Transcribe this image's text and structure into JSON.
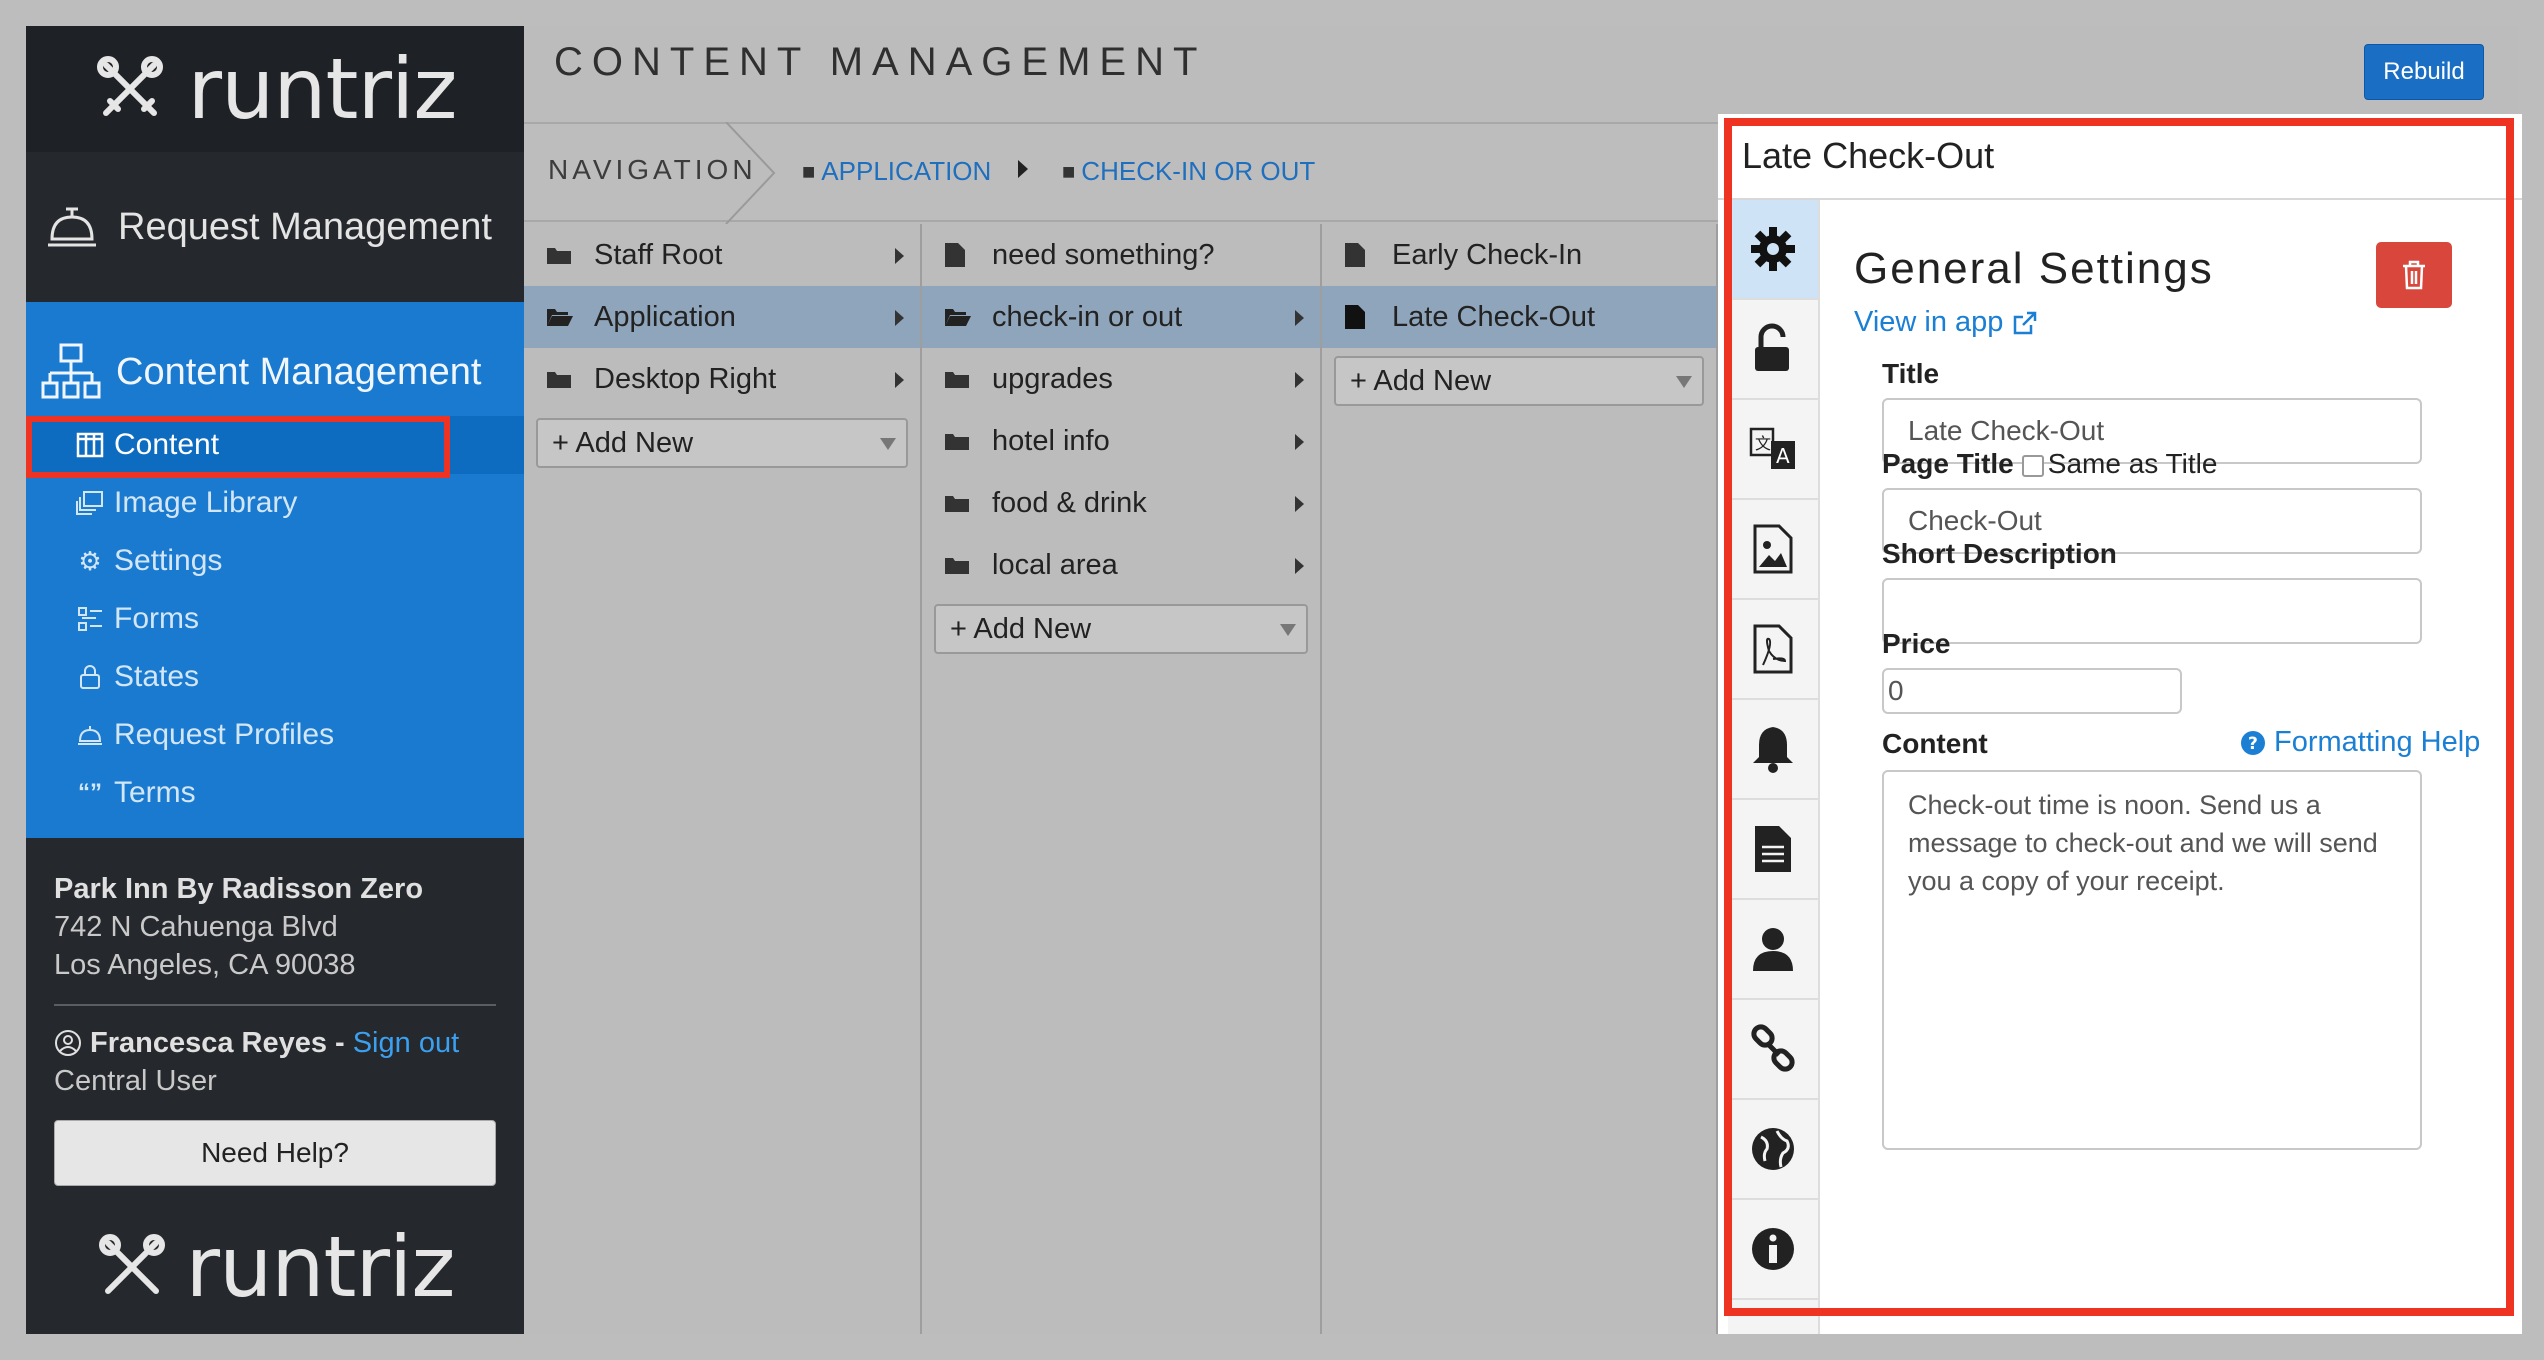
{
  "brand": {
    "logo_text": "runtriz"
  },
  "sidebar": {
    "request_management": "Request Management",
    "content_management": "Content Management",
    "items": [
      {
        "label": "Content",
        "icon": "columns-icon"
      },
      {
        "label": "Image Library",
        "icon": "images-icon"
      },
      {
        "label": "Settings",
        "icon": "gear-icon"
      },
      {
        "label": "Forms",
        "icon": "form-icon"
      },
      {
        "label": "States",
        "icon": "lock-icon"
      },
      {
        "label": "Request Profiles",
        "icon": "bell-icon"
      },
      {
        "label": "Terms",
        "icon": "quote-icon"
      }
    ],
    "hotel": {
      "name": "Park Inn By Radisson Zero",
      "address1": "742 N Cahuenga Blvd",
      "address2": "Los Angeles, CA 90038"
    },
    "user": {
      "name": "Francesca Reyes - ",
      "sign_out": "Sign out",
      "role": "Central User"
    },
    "help_button": "Need Help?"
  },
  "header": {
    "title": "CONTENT MANAGEMENT",
    "rebuild_button": "Rebuild"
  },
  "breadcrumb": {
    "nav_label": "NAVIGATION",
    "items": [
      "APPLICATION",
      "CHECK-IN OR OUT"
    ]
  },
  "columns": {
    "col1": {
      "items": [
        "Staff Root",
        "Application",
        "Desktop Right"
      ],
      "add_new": "+ Add New"
    },
    "col2": {
      "items": [
        "need something?",
        "check-in or out",
        "upgrades",
        "hotel info",
        "food & drink",
        "local area"
      ],
      "add_new": "+ Add New"
    },
    "col3": {
      "items": [
        "Early Check-In",
        "Late Check-Out"
      ],
      "add_new": "+ Add New"
    }
  },
  "panel": {
    "heading": "Late Check-Out",
    "section_title": "General Settings",
    "view_in_app": "View in app",
    "fields": {
      "title_label": "Title",
      "title_value": "Late Check-Out",
      "page_title_label": "Page Title",
      "same_as_title": "Same as Title",
      "page_title_value": "Check-Out",
      "short_desc_label": "Short Description",
      "short_desc_value": "",
      "price_label": "Price",
      "price_value": "0",
      "content_label": "Content",
      "formatting_help": "Formatting Help",
      "content_value": "Check-out time is noon. Send us a message to check-out and we will send you a copy of your receipt."
    }
  },
  "colors": {
    "accent": "#1a7ad0",
    "highlight": "#ee3322",
    "delete": "#d9463b",
    "selected_row": "#8fa5bb"
  }
}
